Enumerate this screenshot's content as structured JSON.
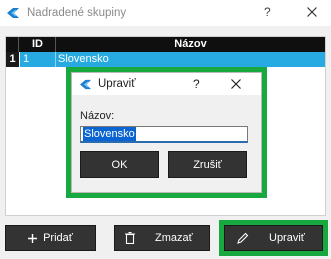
{
  "window": {
    "title": "Nadradené skupiny",
    "help_glyph": "?",
    "close_icon": "close-icon"
  },
  "grid": {
    "columns": [
      "ID",
      "Názov"
    ],
    "rows": [
      {
        "row_number": "1",
        "id": "1",
        "name": "Slovensko"
      }
    ],
    "header_bg": "#0f0f0f",
    "selected_bg": "#27a9e1"
  },
  "dialog": {
    "title": "Upraviť",
    "help_glyph": "?",
    "field_label": "Názov:",
    "field_value": "Slovensko",
    "ok_label": "OK",
    "cancel_label": "Zrušiť"
  },
  "toolbar": {
    "add_label": "Pridať",
    "delete_label": "Zmazať",
    "edit_label": "Upraviť"
  },
  "highlight_color": "#17a940"
}
